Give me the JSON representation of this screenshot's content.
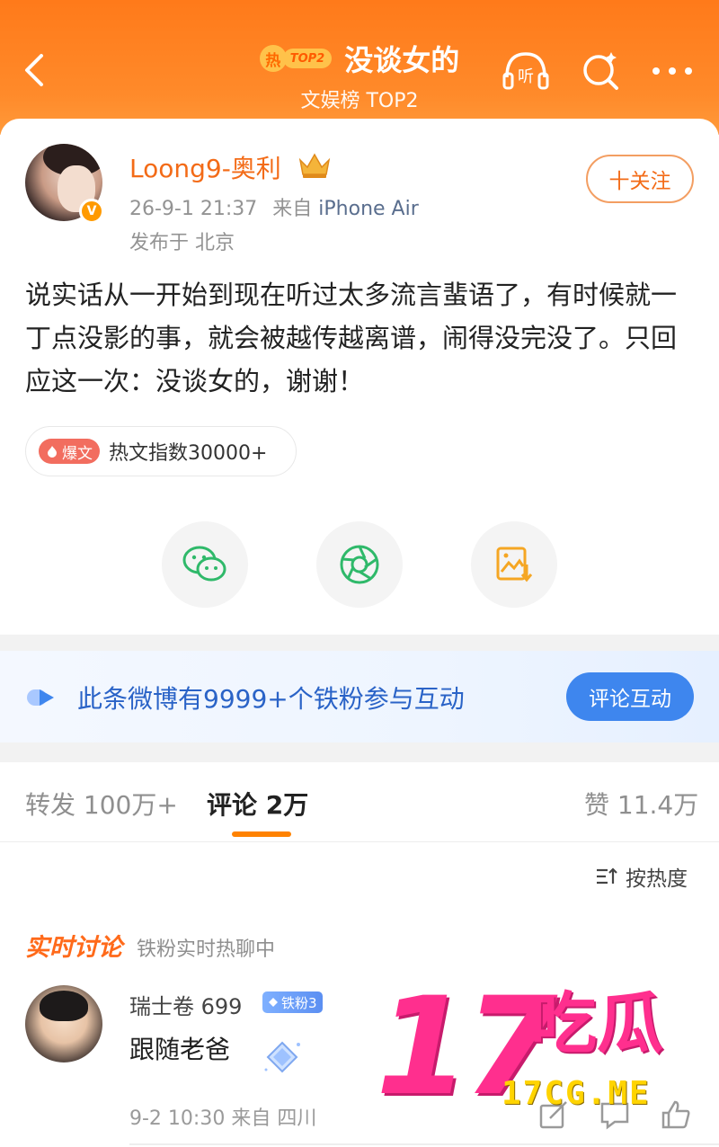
{
  "header": {
    "hot_char": "热",
    "hot_rank": "TOP2",
    "title": "没谈女的",
    "subtitle": "文娱榜 TOP2",
    "listen_label": "听"
  },
  "post": {
    "username": "Loong9-奥利",
    "time": "26-9-1 21:37",
    "source_prefix": "来自",
    "source_device": "iPhone Air",
    "location": "发布于 北京",
    "verified_mark": "V",
    "follow_label": "十关注",
    "content": "说实话从一开始到现在听过太多流言蜚语了，有时候就一丁点没影的事，就会被越传越离谱，闹得没完没了。只回应这一次：没谈女的，谢谢！",
    "hot_badge": "爆文",
    "hot_index": "热文指数30000+"
  },
  "share": {
    "icons": [
      "wechat-icon",
      "moments-icon",
      "save-image-icon"
    ]
  },
  "fan_banner": {
    "text": "此条微博有9999+个铁粉参与互动",
    "button": "评论互动"
  },
  "tabs": {
    "repost": "转发 100万+",
    "comment": "评论 2万",
    "like": "赞 11.4万"
  },
  "sort_label": "按热度",
  "comments": {
    "section_title": "实时讨论",
    "section_sub": "铁粉实时热聊中",
    "items": [
      {
        "name": "瑞士卷 699",
        "badge": "铁粉3",
        "text": "跟随老爸",
        "meta": "9-2 10:30  来自 四川"
      }
    ]
  },
  "watermark": {
    "big": "17",
    "cn": "吃瓜",
    "url": "17CG.ME"
  },
  "colors": {
    "brand_orange": "#ff7a1a",
    "link_blue": "#2a63c7",
    "button_blue": "#3e86ee",
    "watermark_pink": "#ff2f8e"
  }
}
